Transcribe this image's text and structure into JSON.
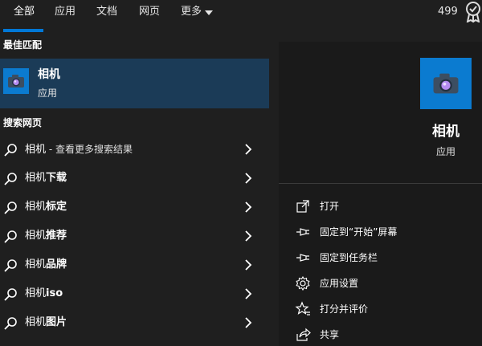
{
  "tabs": [
    {
      "label": "全部",
      "active": true
    },
    {
      "label": "应用"
    },
    {
      "label": "文档"
    },
    {
      "label": "网页"
    },
    {
      "label": "更多"
    }
  ],
  "points": "499",
  "accent_color": "#0078d7",
  "best_match": {
    "section_title": "最佳匹配",
    "title": "相机",
    "subtitle": "应用",
    "icon": "camera-icon"
  },
  "web": {
    "section_title": "搜索网页",
    "items": [
      {
        "prefix": "相机",
        "suffix": " - 查看更多搜索结果",
        "bold": ""
      },
      {
        "prefix": "相机",
        "suffix": "",
        "bold": "下载"
      },
      {
        "prefix": "相机",
        "suffix": "",
        "bold": "标定"
      },
      {
        "prefix": "相机",
        "suffix": "",
        "bold": "推荐"
      },
      {
        "prefix": "相机",
        "suffix": "",
        "bold": "品牌"
      },
      {
        "prefix": "相机",
        "suffix": "",
        "bold": "iso"
      },
      {
        "prefix": "相机",
        "suffix": "",
        "bold": "图片"
      }
    ]
  },
  "preview": {
    "title": "相机",
    "subtitle": "应用",
    "actions": [
      {
        "label": "打开",
        "icon": "open-icon"
      },
      {
        "label": "固定到“开始”屏幕",
        "icon": "pin-icon"
      },
      {
        "label": "固定到任务栏",
        "icon": "pin-icon"
      },
      {
        "label": "应用设置",
        "icon": "gear-icon"
      },
      {
        "label": "打分并评价",
        "icon": "star-rate-icon"
      },
      {
        "label": "共享",
        "icon": "share-icon"
      }
    ]
  }
}
